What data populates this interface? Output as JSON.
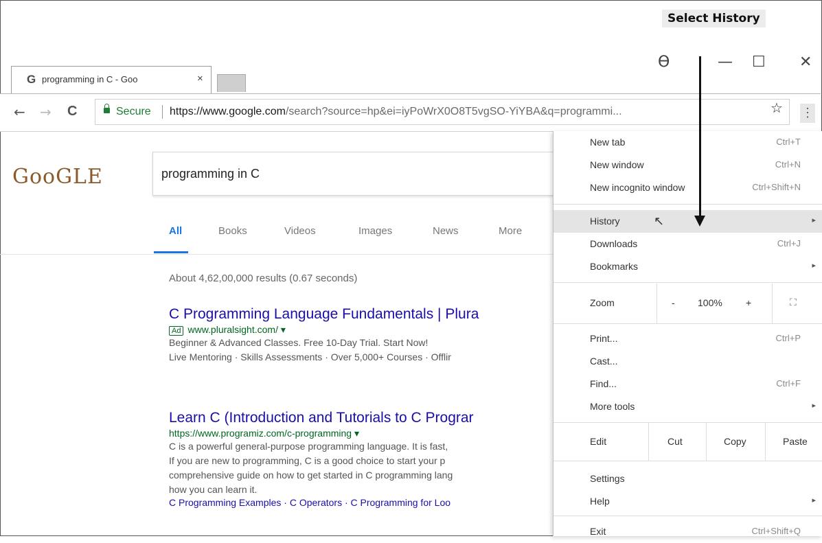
{
  "annotation": {
    "label": "Select History"
  },
  "window": {
    "profile_glyph": "ϴ",
    "minimize_glyph": "—",
    "maximize_glyph": "☐",
    "close_glyph": "✕"
  },
  "tab": {
    "favicon": "G",
    "title": "programming in C - Goo",
    "close_glyph": "×"
  },
  "toolbar": {
    "back_glyph": "←",
    "forward_glyph": "→",
    "reload_glyph": "C",
    "secure_label": "Secure",
    "url_host": "https://www.google.com",
    "url_rest": "/search?source=hp&ei=iyPoWrX0O8T5vgSO-YiYBA&q=programmi...",
    "star_glyph": "☆",
    "menu_glyph": "⋮"
  },
  "page": {
    "logo": "GooGLE",
    "search_query": "programming in C",
    "tabs": [
      "All",
      "Books",
      "Videos",
      "Images",
      "News",
      "More"
    ],
    "stats": "About 4,62,00,000 results (0.67 seconds)",
    "results": [
      {
        "title": "C Programming Language Fundamentals | Plura",
        "ad": "Ad",
        "url": "www.pluralsight.com/ ▾",
        "snippets": [
          "Beginner & Advanced Classes. Free 10-Day Trial. Start Now!",
          "Live Mentoring · Skills Assessments · Over 5,000+ Courses · Offlir"
        ]
      },
      {
        "title": "Learn C (Introduction and Tutorials to C Prograr",
        "url": "https://www.programiz.com/c-programming ▾",
        "snippets": [
          "C is a powerful general-purpose programming language. It is fast,",
          "If you are new to programming, C is a good choice to start your p",
          "comprehensive guide on how to get started in C programming lang",
          "how you can learn it."
        ],
        "links": "C Programming Examples · C Operators · C Programming for Loo"
      }
    ]
  },
  "menu": {
    "new_tab": {
      "label": "New tab",
      "shortcut": "Ctrl+T"
    },
    "new_window": {
      "label": "New window",
      "shortcut": "Ctrl+N"
    },
    "new_incognito": {
      "label": "New incognito window",
      "shortcut": "Ctrl+Shift+N"
    },
    "history": {
      "label": "History",
      "arrow": "▸"
    },
    "downloads": {
      "label": "Downloads",
      "shortcut": "Ctrl+J"
    },
    "bookmarks": {
      "label": "Bookmarks",
      "arrow": "▸"
    },
    "zoom": {
      "label": "Zoom",
      "minus": "-",
      "value": "100%",
      "plus": "+",
      "fullscreen_glyph": "⛶"
    },
    "print": {
      "label": "Print...",
      "shortcut": "Ctrl+P"
    },
    "cast": {
      "label": "Cast..."
    },
    "find": {
      "label": "Find...",
      "shortcut": "Ctrl+F"
    },
    "more_tools": {
      "label": "More tools",
      "arrow": "▸"
    },
    "edit": {
      "label": "Edit",
      "cut": "Cut",
      "copy": "Copy",
      "paste": "Paste"
    },
    "settings": {
      "label": "Settings"
    },
    "help": {
      "label": "Help",
      "arrow": "▸"
    },
    "exit": {
      "label": "Exit",
      "shortcut": "Ctrl+Shift+Q"
    }
  }
}
